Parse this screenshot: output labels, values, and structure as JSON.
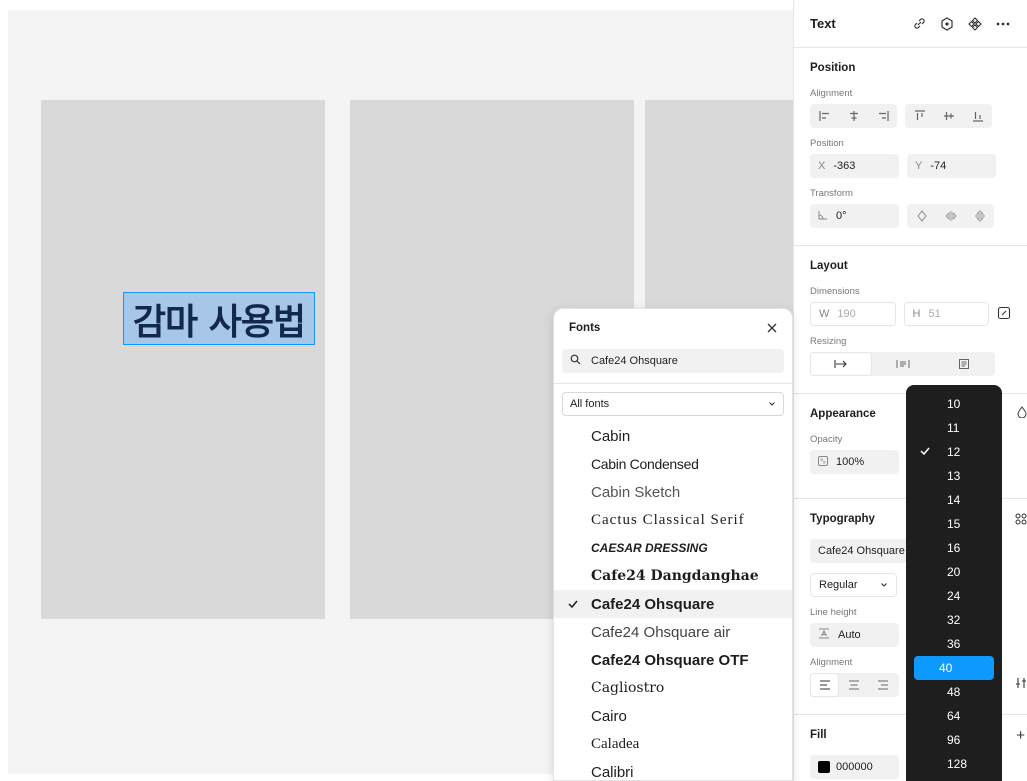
{
  "canvas": {
    "selected_text": "감마 사용법"
  },
  "panel": {
    "title": "Text",
    "header_icons": [
      "link-icon",
      "component-icon",
      "instance-icon",
      "more-icon"
    ],
    "position_section": {
      "title": "Position",
      "alignment_label": "Alignment",
      "position_label": "Position",
      "x_prefix": "X",
      "x_value": "-363",
      "y_prefix": "Y",
      "y_value": "-74",
      "transform_label": "Transform",
      "rotation_value": "0°"
    },
    "layout_section": {
      "title": "Layout",
      "dimensions_label": "Dimensions",
      "w_prefix": "W",
      "w_value": "190",
      "h_prefix": "H",
      "h_value": "51",
      "resizing_label": "Resizing"
    },
    "appearance_section": {
      "title": "Appearance",
      "opacity_label": "Opacity",
      "opacity_value": "100%"
    },
    "typography_section": {
      "title": "Typography",
      "font_value": "Cafe24 Ohsquare",
      "weight_value": "Regular",
      "line_height_label": "Line height",
      "line_height_value": "Auto",
      "alignment_label": "Alignment"
    },
    "fill_section": {
      "title": "Fill",
      "color_value": "000000"
    }
  },
  "size_dropdown": {
    "options": [
      "10",
      "11",
      "12",
      "13",
      "14",
      "15",
      "16",
      "20",
      "24",
      "32",
      "36",
      "40",
      "48",
      "64",
      "96",
      "128"
    ],
    "checked": "12",
    "highlighted": "40"
  },
  "fonts_popup": {
    "title": "Fonts",
    "search_value": "Cafe24 Ohsquare",
    "filter_value": "All fonts",
    "items": [
      "Cabin",
      "Cabin Condensed",
      "Cabin Sketch",
      "Cactus Classical Serif",
      "Caesar Dressing",
      "Cafe24 Dangdanghae",
      "Cafe24 Ohsquare",
      "Cafe24 Ohsquare air",
      "Cafe24 Ohsquare OTF",
      "Cagliostro",
      "Cairo",
      "Caladea",
      "Calibri"
    ],
    "selected": "Cafe24 Ohsquare"
  },
  "colors": {
    "accent": "#0d99ff",
    "dropdown_bg": "#1e1e1e",
    "frame": "#d9d9d9",
    "canvas": "#f4f4f4",
    "selection_fill": "#a8c7e8",
    "selected_text": "#13294b"
  }
}
